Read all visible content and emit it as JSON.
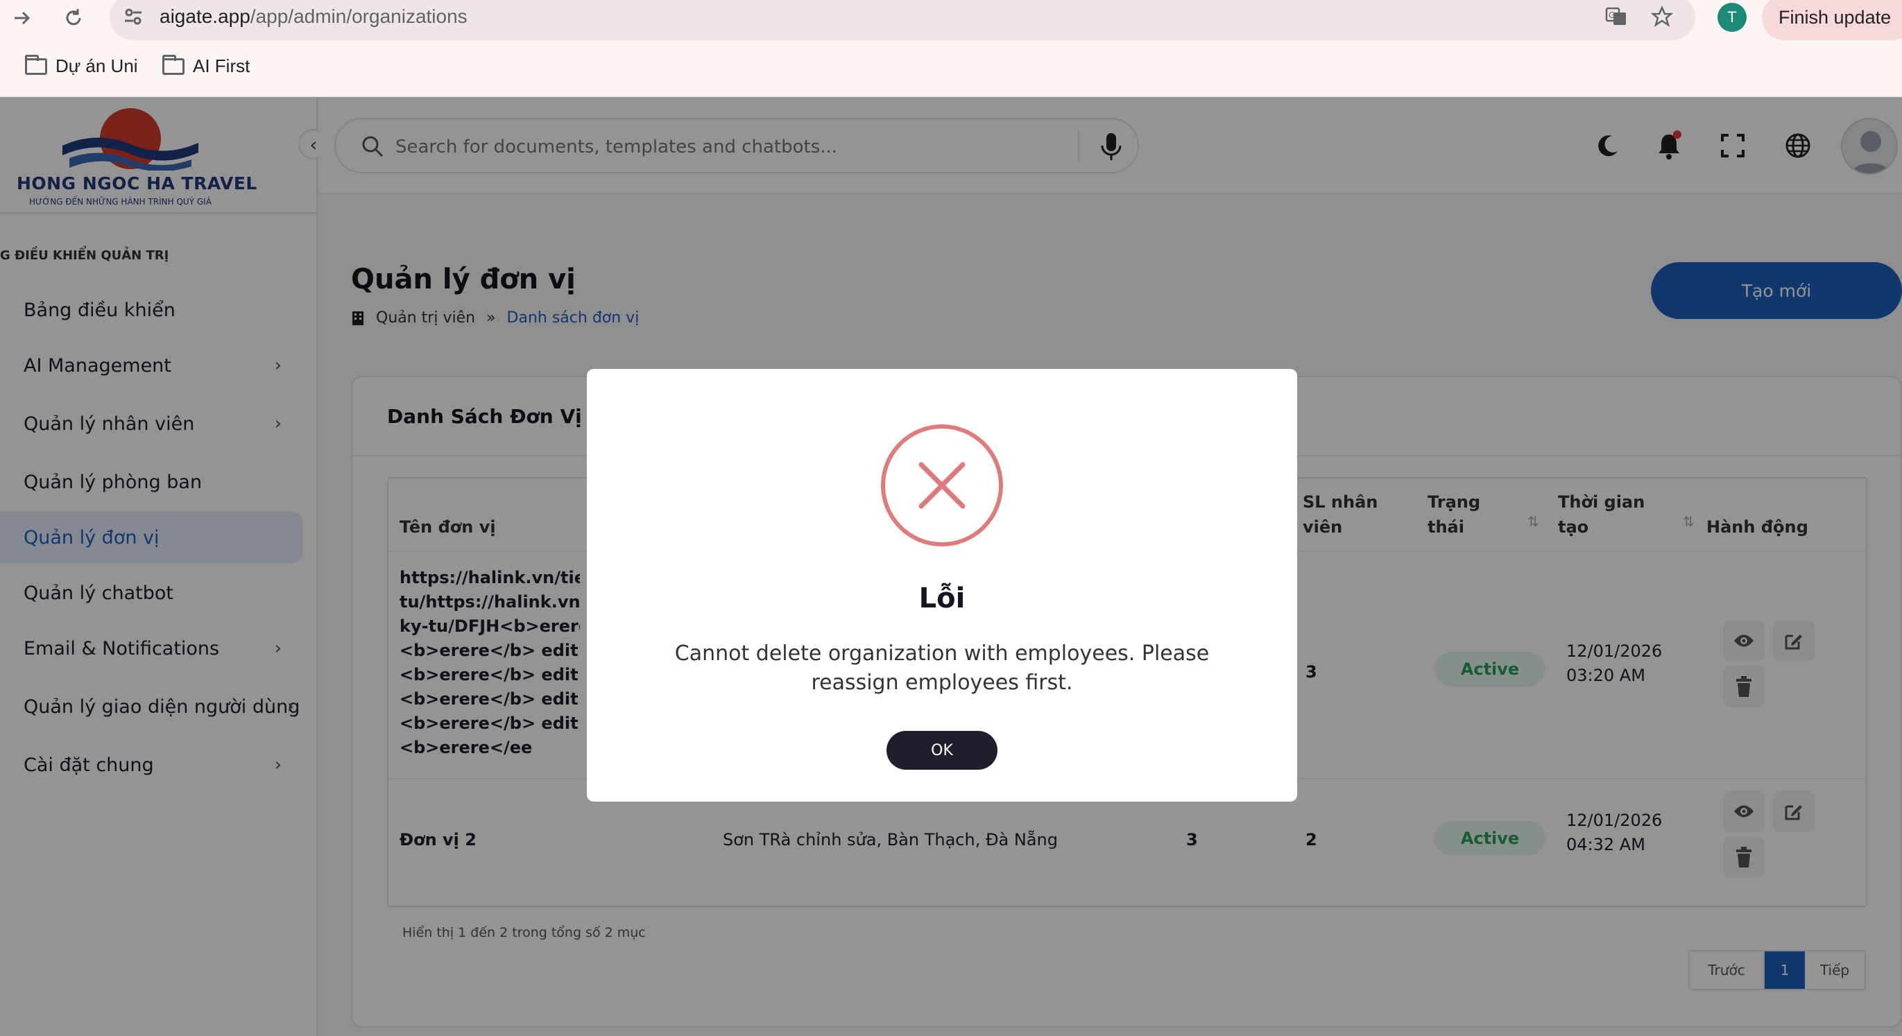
{
  "browser": {
    "url_host": "aigate.app",
    "url_path": "/app/admin/organizations",
    "profile_initial": "T",
    "update_label": "Finish update",
    "bookmarks": [
      "Dự án Uni",
      "AI First"
    ]
  },
  "brand": {
    "name": "HONG NGOC HA TRAVEL",
    "tagline": "HƯỚNG ĐẾN NHỮNG HÀNH TRÌNH QUÝ GIÁ"
  },
  "sidebar": {
    "section": "G ĐIỀU KHIỂN QUẢN TRỊ",
    "items": [
      {
        "label": "Bảng điều khiển",
        "has_chevron": false
      },
      {
        "label": "AI Management",
        "has_chevron": true
      },
      {
        "label": "Quản lý nhân viên",
        "has_chevron": true
      },
      {
        "label": "Quản lý phòng ban",
        "has_chevron": false
      },
      {
        "label": "Quản lý đơn vị",
        "has_chevron": false,
        "active": true
      },
      {
        "label": "Quản lý chatbot",
        "has_chevron": false
      },
      {
        "label": "Email & Notifications",
        "has_chevron": true
      },
      {
        "label": "Quản lý giao diện người dùng",
        "has_chevron": true
      },
      {
        "label": "Cài đặt chung",
        "has_chevron": true
      }
    ]
  },
  "search": {
    "placeholder": "Search for documents, templates and chatbots..."
  },
  "page": {
    "title": "Quản lý đơn vị",
    "breadcrumb_root": "Quản trị viên",
    "breadcrumb_sep": "»",
    "breadcrumb_current": "Danh sách đơn vị",
    "create_label": "Tạo mới"
  },
  "card": {
    "title": "Danh Sách Đơn Vị",
    "columns": {
      "name": "Tên đơn vị",
      "employees_l1": "SL nhân",
      "employees_l2": "viên",
      "status_l1": "Trạng",
      "status_l2": "thái",
      "created_l1": "Thời gian",
      "created_l2": "tạo",
      "actions": "Hành động"
    },
    "rows": [
      {
        "name_lines": [
          "https://halink.vn/tieni",
          "tu/https://halink.vn/ti",
          "ky-tu/DFJH<b>erere</",
          "<b>erere</b> edit <b>e",
          "<b>erere</b> edit <b>e",
          "<b>erere</b> edit <b>e",
          "<b>erere</b> edit <b>e",
          "<b>erere</ee"
        ],
        "employees": "3",
        "status": "Active",
        "date": "12/01/2026",
        "time": "03:20 AM"
      },
      {
        "name": "Đơn vị 2",
        "address": "Sơn TRà chỉnh sửa, Bàn Thạch, Đà Nẵng",
        "departments": "3",
        "employees": "2",
        "status": "Active",
        "date": "12/01/2026",
        "time": "04:32 AM"
      }
    ],
    "footer_info": "Hiển thị 1 đến 2 trong tổng số 2 mục",
    "pager": {
      "prev": "Trước",
      "page": "1",
      "next": "Tiếp"
    }
  },
  "modal": {
    "title": "Lỗi",
    "message": "Cannot delete organization with employees. Please reassign employees first.",
    "ok_label": "OK",
    "icon": "error-x-icon"
  },
  "colors": {
    "accent": "#1f5fbf",
    "error": "#e07b7b",
    "success": "#27a05a",
    "dark_button": "#1e1e2d"
  }
}
